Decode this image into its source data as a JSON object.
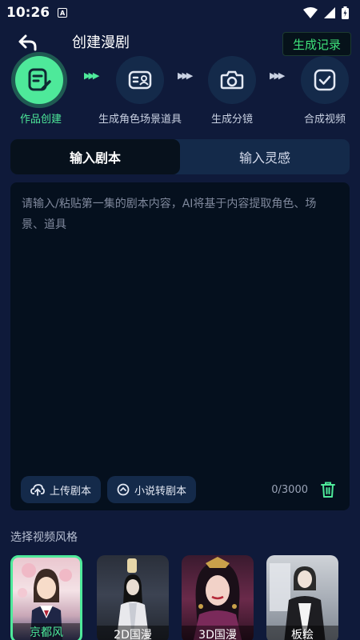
{
  "status": {
    "time": "10:26",
    "badge": "A"
  },
  "header": {
    "title": "创建漫剧",
    "record_label": "生成记录"
  },
  "steps": [
    {
      "label": "作品创建",
      "icon": "edit-doc-icon",
      "active": true
    },
    {
      "label": "生成角色场景道具",
      "icon": "character-card-icon",
      "active": false
    },
    {
      "label": "生成分镜",
      "icon": "camera-icon",
      "active": false
    },
    {
      "label": "合成视频",
      "icon": "check-icon",
      "active": false
    }
  ],
  "tabs": {
    "script": "输入剧本",
    "inspiration": "输入灵感"
  },
  "editor": {
    "placeholder": "请输入/粘贴第一集的剧本内容，AI将基于内容提取角色、场景、道具",
    "upload_label": "上传剧本",
    "novel_label": "小说转剧本",
    "counter": "0/3000"
  },
  "style": {
    "title": "选择视频风格",
    "cards": [
      {
        "name": "京都风",
        "selected": true
      },
      {
        "name": "2D国漫",
        "selected": false
      },
      {
        "name": "3D国漫",
        "selected": false
      },
      {
        "name": "板绘",
        "selected": false
      }
    ]
  },
  "colors": {
    "accent": "#4ee99a",
    "background": "#0f1a3a",
    "panel": "#05101e"
  }
}
